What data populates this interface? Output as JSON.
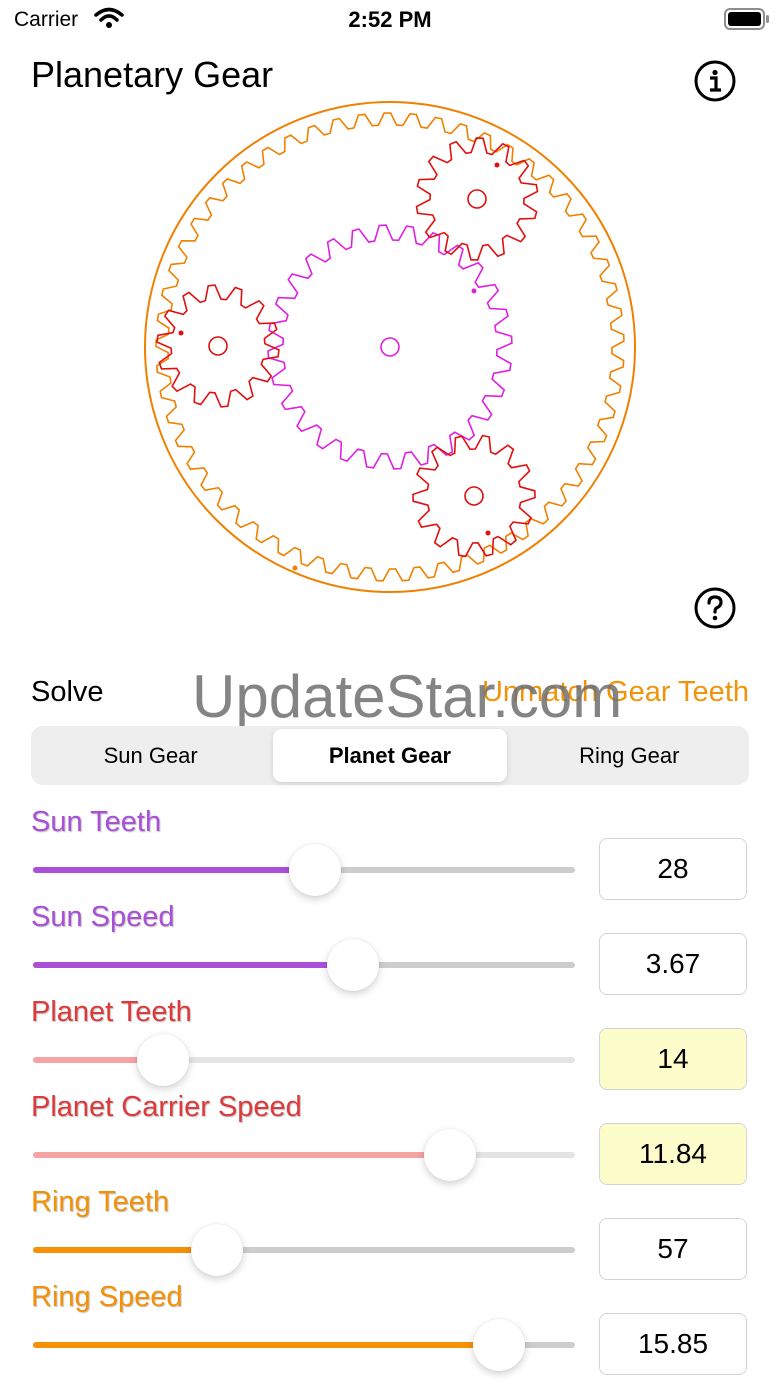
{
  "status_bar": {
    "carrier": "Carrier",
    "time": "2:52 PM"
  },
  "header": {
    "title": "Planetary Gear",
    "info_icon": "info-icon",
    "help_icon": "question-icon"
  },
  "solve": {
    "label": "Solve",
    "mismatch_label": "Unmatch Gear Teeth"
  },
  "watermark": "UpdateStar.com",
  "segmented": {
    "options": [
      "Sun Gear",
      "Planet Gear",
      "Ring Gear"
    ],
    "selected": "Planet Gear"
  },
  "colors": {
    "sun": "#b04fd6",
    "planet": "#e03c3c",
    "ring": "#f0940c",
    "sun_gear_stroke": "#e020e0",
    "planet_gear_stroke": "#e01010",
    "ring_gear_stroke": "#f08000"
  },
  "controls": [
    {
      "label": "Sun Teeth",
      "value": "28",
      "level": 0.52,
      "color": "#a94fd8",
      "track": "#cdcdcd",
      "highlight": false
    },
    {
      "label": "Sun Speed",
      "value": "3.67",
      "level": 0.59,
      "color": "#a94fd8",
      "track": "#cdcdcd",
      "highlight": false
    },
    {
      "label": "Planet Teeth",
      "value": "14",
      "level": 0.24,
      "color": "#f5a3a3",
      "track": "#e4e4e4",
      "highlight": true
    },
    {
      "label": "Planet Carrier Speed",
      "value": "11.84",
      "level": 0.77,
      "color": "#f5a3a3",
      "track": "#e4e4e4",
      "highlight": true
    },
    {
      "label": "Ring Teeth",
      "value": "57",
      "level": 0.34,
      "color": "#f49106",
      "track": "#cdcdcd",
      "highlight": false
    },
    {
      "label": "Ring Speed",
      "value": "15.85",
      "level": 0.86,
      "color": "#f49106",
      "track": "#cdcdcd",
      "highlight": false
    }
  ]
}
